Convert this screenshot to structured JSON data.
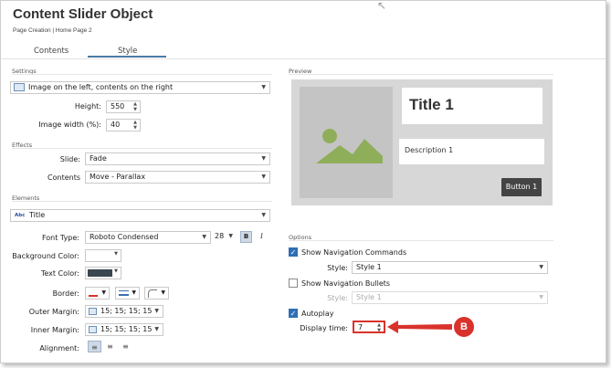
{
  "header": {
    "title": "Content Slider Object",
    "subtitle": "Page Creation | Home Page 2"
  },
  "tabs": [
    {
      "label": "Contents",
      "active": false
    },
    {
      "label": "Style",
      "active": true
    }
  ],
  "settings": {
    "section_label": "Settings",
    "layout_value": "Image on the left, contents on the right",
    "height_label": "Height:",
    "height_value": "550",
    "image_width_label": "Image width (%):",
    "image_width_value": "40"
  },
  "effects": {
    "section_label": "Effects",
    "slide_label": "Slide:",
    "slide_value": "Fade",
    "contents_label": "Contents",
    "contents_value": "Move - Parallax"
  },
  "elements": {
    "section_label": "Elements",
    "element_icon_text": "Abc",
    "element_value": "Title",
    "font_type_label": "Font Type:",
    "font_value": "Roboto Condensed",
    "font_size": "28",
    "bold_label": "B",
    "italic_label": "I",
    "bg_color_label": "Background Color:",
    "bg_color": "#ffffff",
    "text_color_label": "Text Color:",
    "text_color": "#3a4650",
    "border_label": "Border:",
    "outer_margin_label": "Outer Margin:",
    "outer_margin_value": "15; 15; 15; 15",
    "inner_margin_label": "Inner Margin:",
    "inner_margin_value": "15; 15; 15; 15",
    "alignment_label": "Alignment:"
  },
  "preview": {
    "section_label": "Preview",
    "title_text": "Title 1",
    "description_text": "Description 1",
    "button_text": "Button 1"
  },
  "options": {
    "section_label": "Options",
    "nav_commands_label": "Show Navigation Commands",
    "nav_commands_checked": true,
    "nav_style_label": "Style:",
    "nav_style_value": "Style 1",
    "nav_bullets_label": "Show Navigation Bullets",
    "nav_bullets_checked": false,
    "bullets_style_label": "Style:",
    "bullets_style_value": "Style 1",
    "autoplay_label": "Autoplay",
    "autoplay_checked": true,
    "display_time_label": "Display time:",
    "display_time_value": "7"
  },
  "annotation": {
    "badge_text": "B",
    "color": "#d9322c"
  }
}
